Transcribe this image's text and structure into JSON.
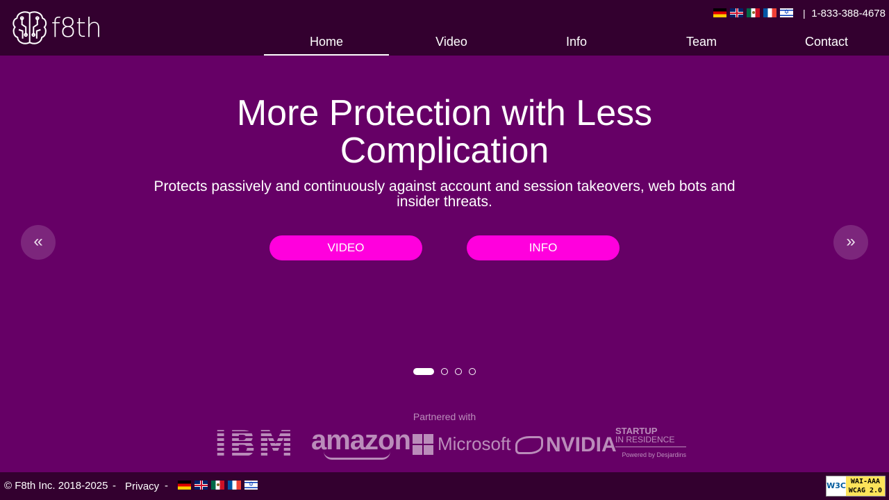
{
  "header": {
    "logo_text": "f8th",
    "phone": "1-833-388-4678",
    "separator": "|",
    "languages": [
      "German",
      "English",
      "Spanish",
      "French",
      "Hebrew"
    ],
    "nav": [
      {
        "label": "Home",
        "active": true
      },
      {
        "label": "Video",
        "active": false
      },
      {
        "label": "Info",
        "active": false
      },
      {
        "label": "Team",
        "active": false
      },
      {
        "label": "Contact",
        "active": false
      }
    ]
  },
  "hero": {
    "title": "More Protection with Less Complication",
    "subtitle": "Protects passively and continuously against account and session takeovers, web bots and insider threats.",
    "video_button": "VIDEO",
    "info_button": "INFO",
    "prev_arrow": "«",
    "next_arrow": "»",
    "slides_total": 4,
    "active_slide": 1
  },
  "partners": {
    "label": "Partnered with",
    "ibm": "IBM",
    "amazon": "amazon",
    "microsoft": "Microsoft",
    "nvidia": "NVIDIA",
    "startup_line1": "STARTUP",
    "startup_line2": "IN RESIDENCE",
    "startup_line3": "Powered by  Desjardins"
  },
  "footer": {
    "copyright": "© F8th Inc. 2018-2025",
    "dash": "-",
    "privacy": "Privacy",
    "badge_left": "W3C",
    "badge_line1": "WAI-AAA",
    "badge_line2": "WCAG 2.0"
  },
  "colors": {
    "background": "#660066",
    "header_bg": "#33002f",
    "button": "#ff00dd"
  }
}
